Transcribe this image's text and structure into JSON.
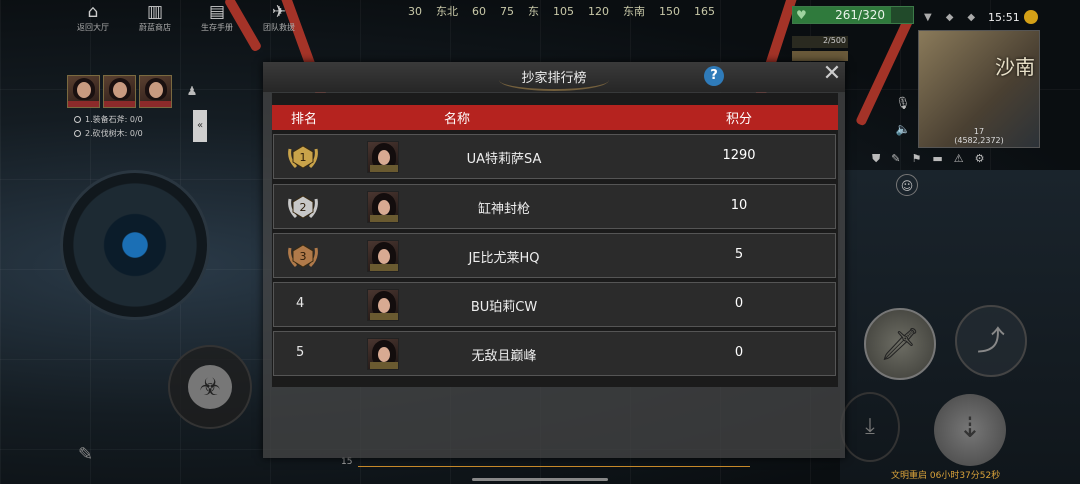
{
  "topmenu": [
    {
      "label": "返回大厅",
      "icon": "home-icon"
    },
    {
      "label": "蔚蓝商店",
      "icon": "shop-icon"
    },
    {
      "label": "生存手册",
      "icon": "book-icon"
    },
    {
      "label": "团队救援",
      "icon": "rescue-icon"
    }
  ],
  "compass": [
    "30",
    "东北",
    "60",
    "75",
    "东",
    "105",
    "120",
    "东南",
    "150",
    "165"
  ],
  "hud": {
    "hp": "261/320",
    "sub_value": "2/500",
    "time": "15:51",
    "minimap_region": "沙南",
    "minimap_coords_line1": "17",
    "minimap_coords_line2": "(4582,2372)"
  },
  "quests": [
    "1.装备石斧: 0/0",
    "2.砍伐树木: 0/0"
  ],
  "collapse_label": "«",
  "bottom": {
    "scale_start": "15",
    "timer": "文明重启 06小时37分52秒"
  },
  "modal": {
    "title": "抄家排行榜",
    "help_label": "?",
    "close_label": "✕",
    "headers": {
      "rank": "排名",
      "name": "名称",
      "score": "积分"
    },
    "rows": [
      {
        "rank": "1",
        "name": "UA特莉萨SA",
        "score": "1290",
        "medal": "gold"
      },
      {
        "rank": "2",
        "name": "缸神封枪",
        "score": "10",
        "medal": "silver"
      },
      {
        "rank": "3",
        "name": "JE比尤莱HQ",
        "score": "5",
        "medal": "bronze"
      },
      {
        "rank": "4",
        "name": "BU珀莉CW",
        "score": "0",
        "medal": ""
      },
      {
        "rank": "5",
        "name": "无敌且巅峰",
        "score": "0",
        "medal": ""
      }
    ]
  },
  "colors": {
    "header_red": "#b5231f",
    "gold": "#c9a34a",
    "silver": "#c8c8c8",
    "bronze": "#b07a4a",
    "hp_green": "#2f7a3c",
    "help_blue": "#2f7bb9"
  }
}
